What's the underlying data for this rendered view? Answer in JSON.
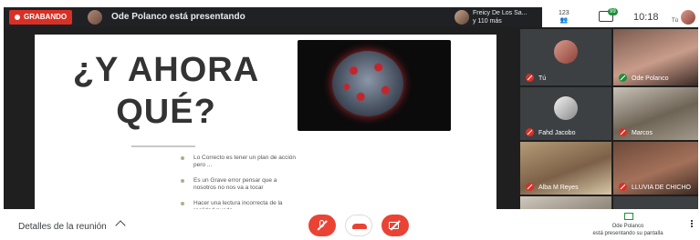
{
  "topbar": {
    "recording_label": "GRABANDO",
    "presenter_text": "Ode Polanco está presentando",
    "people_line1": "Freicy De Los Sa...",
    "people_line2": "y 110 más",
    "participant_count": "123",
    "chat_badge": "99",
    "clock": "10:18",
    "self_label": "Tú"
  },
  "slide": {
    "title_line1": "¿Y AHORA",
    "title_line2": "QUÉ?",
    "bullets": [
      "Lo Correcto es tener un plan de acción pero ...",
      "Es un Grave error pensar que a nosotros no nos va a tocar",
      "Hacer una lectura incorrecta de la realidad puede"
    ]
  },
  "participants": {
    "tu": "Tú",
    "ode": "Ode Polanco",
    "fahd": "Fahd Jacobo",
    "marcos": "Marcos",
    "alba": "Alba M Reyes",
    "lluvia": "LLUVIA DE CHICHO"
  },
  "bottombar": {
    "details_label": "Detalles de la reunión",
    "present_line1": "Ode Polanco",
    "present_line2": "está presentando su pantalla"
  },
  "colors": {
    "recording": "#d93025",
    "control_red": "#ea4335",
    "present_green": "#1e8e3e"
  }
}
